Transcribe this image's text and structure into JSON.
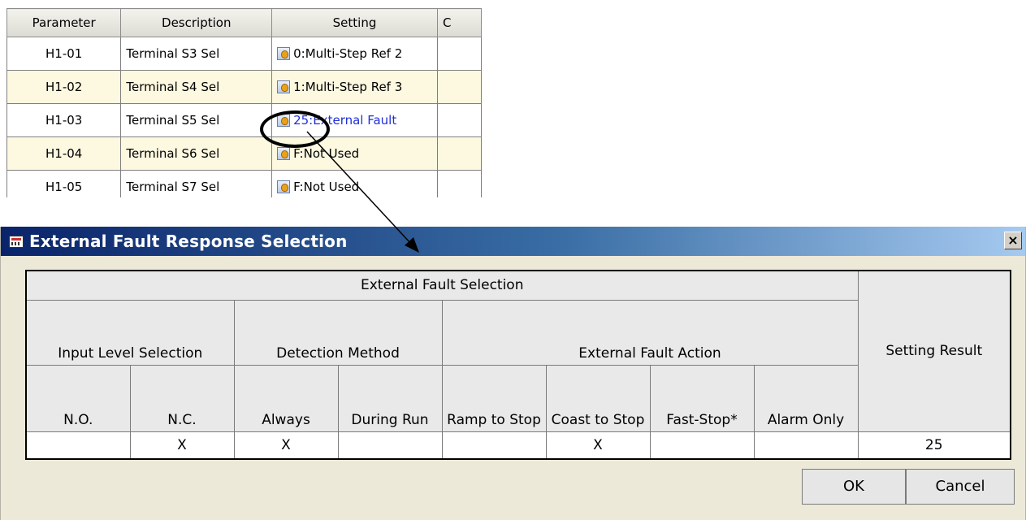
{
  "param_table": {
    "columns": [
      "Parameter",
      "Description",
      "Setting",
      "C"
    ],
    "rows": [
      {
        "param": "H1-01",
        "desc": "Terminal S3 Sel",
        "setting": "0:Multi-Step Ref 2"
      },
      {
        "param": "H1-02",
        "desc": "Terminal S4 Sel",
        "setting": "1:Multi-Step Ref 3"
      },
      {
        "param": "H1-03",
        "desc": "Terminal S5 Sel",
        "setting": "25:External Fault"
      },
      {
        "param": "H1-04",
        "desc": "Terminal S6 Sel",
        "setting": "F:Not Used"
      },
      {
        "param": "H1-05",
        "desc": "Terminal S7 Sel",
        "setting": "F:Not Used"
      }
    ]
  },
  "dialog": {
    "title": "External Fault Response Selection",
    "close": "×",
    "table": {
      "group_header": "External Fault Selection",
      "setting_result_header": "Setting Result",
      "sub_headers": {
        "input_level": "Input Level Selection",
        "detection": "Detection Method",
        "action": "External Fault Action"
      },
      "columns": [
        "N.O.",
        "N.C.",
        "Always",
        "During Run",
        "Ramp to Stop",
        "Coast to Stop",
        "Fast-Stop*",
        "Alarm Only"
      ],
      "marks": [
        "",
        "X",
        "X",
        "",
        "",
        "X",
        "",
        ""
      ],
      "result": "25"
    },
    "buttons": {
      "ok": "OK",
      "cancel": "Cancel"
    }
  },
  "colors": {
    "title_bar_start": "#0a246a",
    "title_bar_end": "#a6caf0",
    "highlight_text": "#1f2fd6",
    "alt_row": "#fdf8e0",
    "dialog_bg": "#ece9d8"
  },
  "icons": {
    "setting": "setting-icon",
    "title": "dialog-app-icon",
    "close": "close-icon"
  }
}
